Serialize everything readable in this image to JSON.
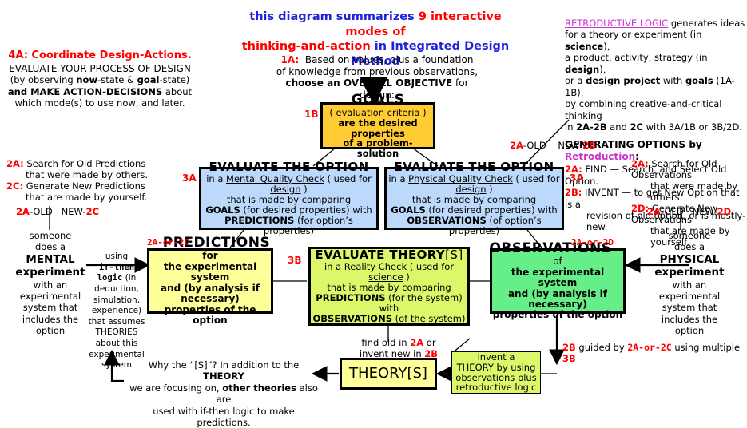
{
  "header": {
    "line1_a": "this diagram summarizes ",
    "line1_b": "9 interactive modes of",
    "line2_a": "thinking-and-action",
    "line2_b": " in Integrated Design Method"
  },
  "top_left": {
    "title": "4A:  Coordinate Design-Actions.",
    "l1": "EVALUATE YOUR PROCESS OF DESIGN",
    "l2_a": "(by observing ",
    "l2_b": "now",
    "l2_c": "-state & ",
    "l2_d": "goal",
    "l2_e": "-state)",
    "l3_a": "and MAKE ACTION-DECISIONS",
    "l3_b": " about",
    "l4": "which mode(s) to use now, and later."
  },
  "top_center": {
    "tag": "1A:",
    "l1": "Based on values, plus a foundation",
    "l2": "of knowledge from previous observations,",
    "l3_a": "choose an OVERALL OBJECTIVE",
    "l3_b": " for design:"
  },
  "top_right": {
    "title_u": "RETRODUCTIVE LOGIC",
    "title_rest": " generates ideas",
    "l1_a": "for a theory or experiment (in ",
    "l1_b": "science",
    "l1_c": "),",
    "l2_a": "a product, activity, strategy (in ",
    "l2_b": "design",
    "l2_c": "),",
    "l3_a": "or a ",
    "l3_b": "design project",
    "l3_c": " with ",
    "l3_d": "goals",
    "l3_e": " (1A-1B),",
    "l4": "by combining creative-and-critical thinking",
    "l5_a": "in ",
    "l5_b": "2A-2B",
    "l5_c": " and ",
    "l5_d": "2C",
    "l5_e": " with 3A/1B or 3B/2D.",
    "gen_a": "GENERATING OPTIONS by ",
    "gen_b": "Retroduction",
    "gen_c": ":",
    "t2a_tag": "2A:",
    "t2a_txt": "FIND — Search, and Select Old Option.",
    "t2b_tag": "2B:",
    "t2b_txt": "INVENT — to get New Option that is a",
    "t2b_txt2": "revision of old option, or is mostly-new."
  },
  "boxes": {
    "goals": {
      "label": "1B",
      "title": "GOALS",
      "l1": "( evaluation criteria )",
      "l2": "are the desired properties",
      "l3": "of a problem-solution"
    },
    "eval_mental": {
      "label": "3A",
      "title": "EVALUATE THE OPTION",
      "l1_a": "in a ",
      "l1_b": "Mental Quality Check",
      "l1_c": "  ( used for ",
      "l1_d": "design",
      "l1_e": " )",
      "l2": "that is made by comparing",
      "l3_a": "GOALS",
      "l3_b": " (for desired properties) with",
      "l4_a": "PREDICTIONS",
      "l4_b": " (for option’s properties)"
    },
    "eval_physical": {
      "label": "3A",
      "title": "EVALUATE THE OPTION",
      "l1_a": "in a ",
      "l1_b": "Physical Quality Check",
      "l1_c": "  ( used for ",
      "l1_d": "design",
      "l1_e": " )",
      "l2": "that is made by comparing",
      "l3_a": "GOALS",
      "l3_b": " (for desired properties) with",
      "l4_a": "OBSERVATIONS",
      "l4_b": " (of option’s properties)"
    },
    "predictions": {
      "label": "2A-or-2C",
      "title": "PREDICTIONS",
      "l1": "for",
      "l2": "the experimental system",
      "l3": "and (by analysis if necessary)",
      "l4": "properties of the option"
    },
    "eval_theory": {
      "label": "3B",
      "title_a": "EVALUATE THEORY",
      "title_b": "[S]",
      "l1_a": "in a ",
      "l1_b": "Reality Check",
      "l1_c": " ( used for ",
      "l1_d": "science",
      "l1_e": " )",
      "l2": "that is made by comparing",
      "l3_a": "PREDICTIONS",
      "l3_b": " (for the system)",
      "l4": "with",
      "l5_a": "OBSERVATIONS",
      "l5_b": " (of the system)"
    },
    "observations": {
      "label": "2A-or-2D",
      "title": "OBSERVATIONS",
      "l1": "of",
      "l2": "the experimental system",
      "l3": "and (by analysis if necessary)",
      "l4": "properties of the option"
    },
    "theory": {
      "title_a": "THEORY",
      "title_b": "[S]"
    },
    "invent": {
      "l1": "invent a",
      "l2": "THEORY by using",
      "l3": "observations plus",
      "l4": "retroductive logic"
    }
  },
  "left_mid": {
    "t2a_tag": "2A:",
    "t2a_l1": "Search for Old Predictions",
    "t2a_l2": "that were made by others.",
    "t2c_tag": "2C:",
    "t2c_l1": "Generate New Predictions",
    "t2c_l2": "that are made by yourself.",
    "old_a": "2A",
    "old_b": "-OLD",
    "new_a": "NEW-",
    "new_b": "2C",
    "s1": "someone",
    "s2": "does a",
    "s3": "MENTAL",
    "s4": "experiment",
    "s5": "with an",
    "s6": "experimental",
    "s7": "system that",
    "s8": "includes the",
    "s9": "option"
  },
  "right_mid": {
    "t2a_tag": "2A:",
    "t2a_l1": "Search for Old Observations",
    "t2a_l2": "that were made by others.",
    "t2d_tag": "2D:",
    "t2d_l1": "Generate New Observations",
    "t2d_l2": "that are made by yourself.",
    "old_a": "2A",
    "old_b": "-OLD",
    "new_a": "NEW-",
    "new_b": "2D",
    "s1": "someone",
    "s2": "does a",
    "s3": "PHYSICAL",
    "s4": "experiment",
    "s5": "with an",
    "s6": "experimental",
    "s7": "system that",
    "s8": "includes the",
    "s9": "option"
  },
  "ifthen": {
    "l1": "using",
    "l2": "if-then",
    "l3_a": "logic",
    "l3_b": " (in",
    "l4": "deduction,",
    "l5": "simulation,",
    "l6": "experience)",
    "l7": "that assumes",
    "l8": "THEORIES",
    "l9": "about this",
    "l10": "experimental",
    "l11": "system"
  },
  "mid_labels": {
    "old_new_b_a": "2A",
    "old_new_b_b": "-OLD",
    "old_new_b_c": "NEW-",
    "old_new_b_d": "2B"
  },
  "bottom": {
    "why_l1_a": "Why the “[S]”?",
    "why_l1_b": "   In addition to the ",
    "why_l1_c": "THEORY",
    "why_l2_a": "we are focusing on, ",
    "why_l2_b": "other theories",
    "why_l2_c": " also are",
    "why_l3": "used with if-then logic to make predictions.",
    "find_l1_a": "find old in ",
    "find_l1_b": "2A",
    "find_l1_c": " or",
    "find_l2_a": "invent new in ",
    "find_l2_b": "2B",
    "guided_a": "2B",
    "guided_b": " guided by ",
    "guided_c": "2A-or-2C",
    "guided_d": " using multiple ",
    "guided_e": "3B"
  },
  "colors": {
    "goals_bg": "#ffcc33",
    "blue_bg": "#bcd9fb",
    "yellow_bg": "#ffff99",
    "green_bg": "#66ee88",
    "lime_bg": "#ddf76a",
    "red": "#ff0000",
    "magenta": "#cc33cc",
    "blue_text": "#2222dd"
  }
}
